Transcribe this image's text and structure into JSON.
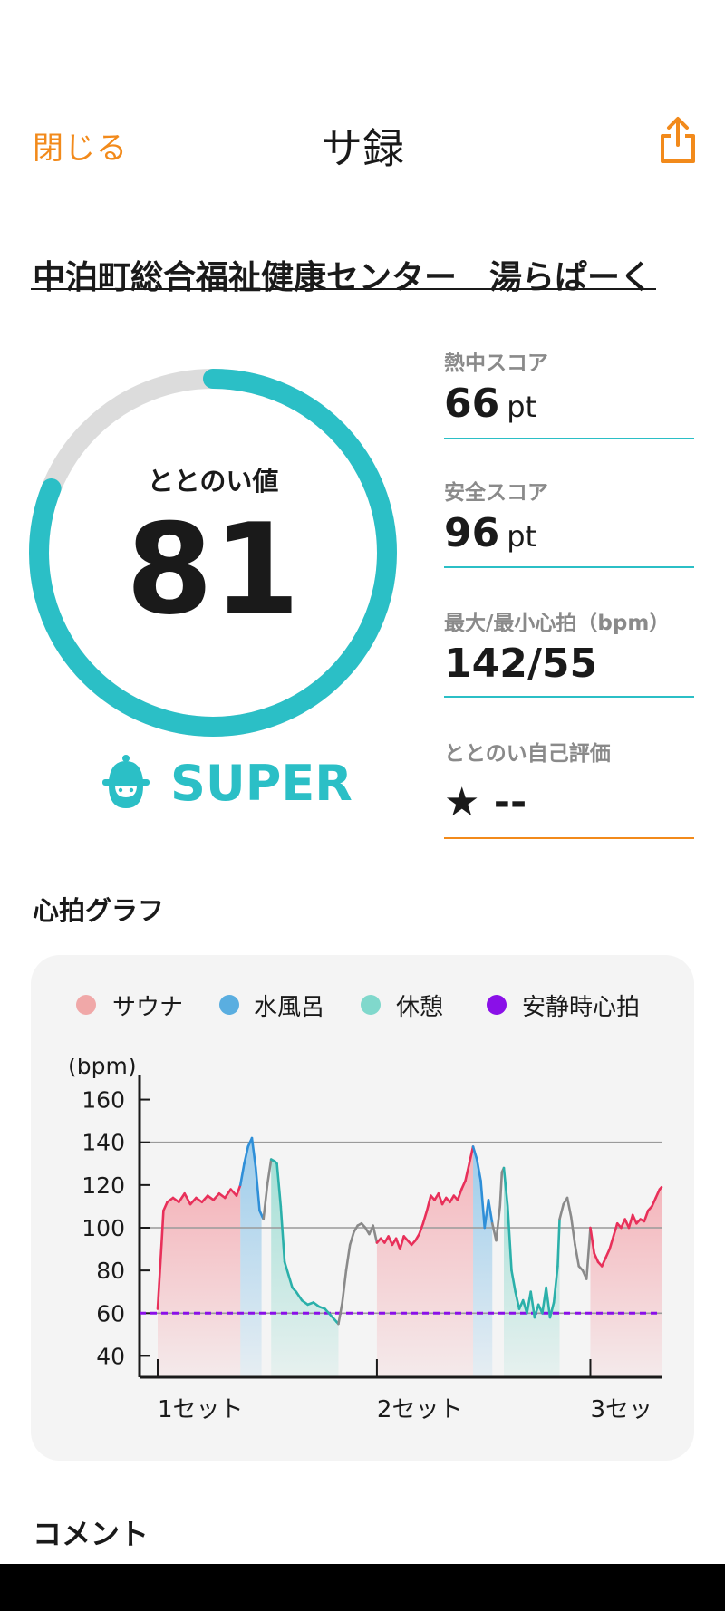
{
  "header": {
    "close_label": "閉じる",
    "title": "サ録",
    "share_icon": "share-icon"
  },
  "facility": {
    "name": "中泊町総合福祉健康センター　湯らぱーく"
  },
  "totonoi": {
    "label": "ととのい値",
    "value": "81",
    "progress_fraction": 0.81,
    "level_label": "SUPER",
    "level_icon": "sauna-hat-face-icon",
    "ring_color": "#2bbfc6",
    "ring_track_color": "#dcdcdc"
  },
  "scores": [
    {
      "label": "熱中スコア",
      "value": "66",
      "unit": "pt"
    },
    {
      "label": "安全スコア",
      "value": "96",
      "unit": "pt"
    },
    {
      "label": "最大/最小心拍（bpm）",
      "value": "142/55",
      "unit": ""
    },
    {
      "label": "ととのい自己評価",
      "value": "★ --",
      "unit": ""
    }
  ],
  "graph": {
    "title": "心拍グラフ",
    "legend": [
      {
        "label": "サウナ",
        "color": "#f0a8a8"
      },
      {
        "label": "水風呂",
        "color": "#5aaee0"
      },
      {
        "label": "休憩",
        "color": "#80d8cc"
      },
      {
        "label": "安静時心拍",
        "color": "#8a10e8"
      }
    ]
  },
  "comment": {
    "label": "コメント"
  },
  "colors": {
    "accent": "#f28a1b",
    "teal": "#2bbfc6",
    "sauna_line": "#e8305a",
    "cold_line": "#2f8fd8",
    "rest_line": "#2bb0aa",
    "other_line": "#8a8a8a",
    "resting_line": "#8a10e8"
  },
  "chart_data": {
    "type": "line",
    "ylabel": "(bpm)",
    "ylim": [
      30,
      170
    ],
    "yticks": [
      40,
      60,
      80,
      100,
      120,
      140,
      160
    ],
    "gridlines": [
      60,
      100,
      140
    ],
    "xticks": [
      {
        "label": "1セット",
        "index": 0
      },
      {
        "label": "2セット",
        "index": 114
      },
      {
        "label": "3セッ",
        "index": 225
      }
    ],
    "resting_heart_rate": 60,
    "phases": [
      {
        "type": "sauna",
        "start": 0,
        "end": 43
      },
      {
        "type": "cold",
        "start": 43,
        "end": 54
      },
      {
        "type": "rest",
        "start": 59,
        "end": 94
      },
      {
        "type": "sauna",
        "start": 114,
        "end": 164
      },
      {
        "type": "cold",
        "start": 164,
        "end": 174
      },
      {
        "type": "rest",
        "start": 180,
        "end": 209
      },
      {
        "type": "sauna",
        "start": 225,
        "end": 262
      }
    ],
    "series": [
      {
        "points": [
          [
            0,
            62
          ],
          [
            2,
            92
          ],
          [
            3,
            108
          ],
          [
            5,
            112
          ],
          [
            8,
            114
          ],
          [
            11,
            112
          ],
          [
            14,
            116
          ],
          [
            17,
            111
          ],
          [
            20,
            114
          ],
          [
            23,
            112
          ],
          [
            26,
            115
          ],
          [
            29,
            113
          ],
          [
            32,
            116
          ],
          [
            35,
            114
          ],
          [
            38,
            118
          ],
          [
            41,
            115
          ],
          [
            43,
            120
          ],
          [
            45,
            130
          ],
          [
            47,
            138
          ],
          [
            49,
            142
          ],
          [
            51,
            128
          ],
          [
            53,
            108
          ],
          [
            55,
            104
          ],
          [
            57,
            120
          ],
          [
            59,
            132
          ],
          [
            61,
            131
          ],
          [
            62,
            130
          ],
          [
            64,
            110
          ],
          [
            66,
            84
          ],
          [
            68,
            78
          ],
          [
            70,
            72
          ],
          [
            72,
            70
          ],
          [
            75,
            66
          ],
          [
            78,
            64
          ],
          [
            81,
            65
          ],
          [
            84,
            63
          ],
          [
            87,
            62
          ],
          [
            89,
            60
          ],
          [
            91,
            58
          ],
          [
            93,
            56
          ],
          [
            94,
            55
          ],
          [
            96,
            65
          ],
          [
            98,
            80
          ],
          [
            100,
            92
          ],
          [
            102,
            98
          ],
          [
            104,
            101
          ],
          [
            106,
            102
          ],
          [
            108,
            100
          ],
          [
            110,
            97
          ],
          [
            112,
            101
          ],
          [
            114,
            93
          ],
          [
            116,
            95
          ],
          [
            118,
            93
          ],
          [
            120,
            96
          ],
          [
            122,
            92
          ],
          [
            124,
            95
          ],
          [
            126,
            90
          ],
          [
            128,
            96
          ],
          [
            130,
            94
          ],
          [
            132,
            92
          ],
          [
            134,
            94
          ],
          [
            136,
            97
          ],
          [
            138,
            102
          ],
          [
            140,
            108
          ],
          [
            142,
            115
          ],
          [
            144,
            113
          ],
          [
            146,
            116
          ],
          [
            148,
            111
          ],
          [
            150,
            114
          ],
          [
            152,
            112
          ],
          [
            154,
            115
          ],
          [
            156,
            113
          ],
          [
            158,
            118
          ],
          [
            160,
            122
          ],
          [
            162,
            130
          ],
          [
            164,
            138
          ],
          [
            166,
            132
          ],
          [
            168,
            122
          ],
          [
            170,
            100
          ],
          [
            172,
            113
          ],
          [
            174,
            102
          ],
          [
            176,
            94
          ],
          [
            178,
            110
          ],
          [
            179,
            126
          ],
          [
            180,
            128
          ],
          [
            182,
            110
          ],
          [
            184,
            80
          ],
          [
            186,
            70
          ],
          [
            188,
            62
          ],
          [
            190,
            66
          ],
          [
            192,
            60
          ],
          [
            194,
            70
          ],
          [
            196,
            58
          ],
          [
            198,
            64
          ],
          [
            200,
            60
          ],
          [
            202,
            72
          ],
          [
            204,
            58
          ],
          [
            206,
            65
          ],
          [
            208,
            82
          ],
          [
            209,
            104
          ],
          [
            211,
            111
          ],
          [
            213,
            114
          ],
          [
            215,
            105
          ],
          [
            217,
            92
          ],
          [
            219,
            82
          ],
          [
            221,
            80
          ],
          [
            223,
            76
          ],
          [
            225,
            100
          ],
          [
            227,
            88
          ],
          [
            229,
            84
          ],
          [
            231,
            82
          ],
          [
            233,
            86
          ],
          [
            235,
            90
          ],
          [
            237,
            96
          ],
          [
            239,
            102
          ],
          [
            241,
            100
          ],
          [
            243,
            104
          ],
          [
            245,
            100
          ],
          [
            247,
            106
          ],
          [
            249,
            102
          ],
          [
            251,
            104
          ],
          [
            253,
            103
          ],
          [
            255,
            108
          ],
          [
            257,
            110
          ],
          [
            259,
            114
          ],
          [
            261,
            118
          ],
          [
            262,
            119
          ]
        ]
      }
    ],
    "x_count": 262
  }
}
